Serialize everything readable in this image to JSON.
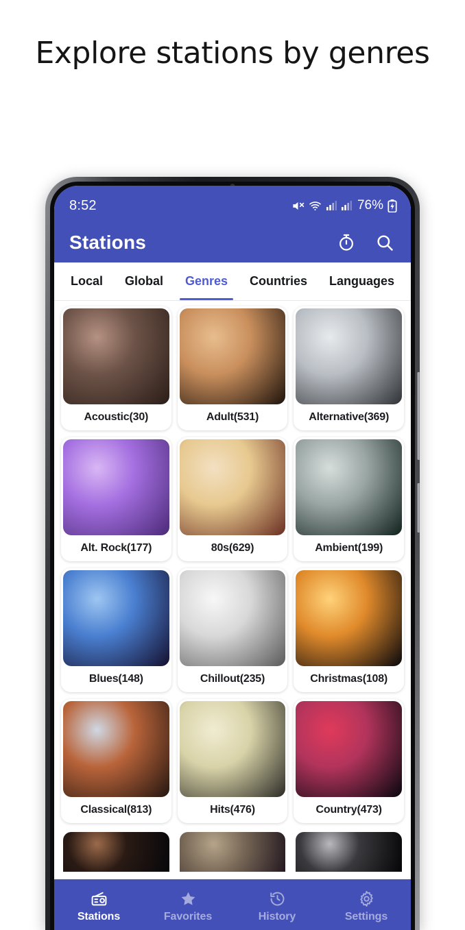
{
  "headline": "Explore stations by genres",
  "statusbar": {
    "time": "8:52",
    "battery_percent": "76%",
    "icons": [
      "mute-icon",
      "wifi-icon",
      "signal-icon",
      "signal-icon",
      "battery-charging-icon"
    ]
  },
  "appbar": {
    "title": "Stations",
    "actions": [
      {
        "name": "sleep-timer-icon",
        "label": "Sleep timer"
      },
      {
        "name": "search-icon",
        "label": "Search"
      }
    ]
  },
  "tabs": [
    {
      "label": "Local",
      "active": false
    },
    {
      "label": "Global",
      "active": false
    },
    {
      "label": "Genres",
      "active": true
    },
    {
      "label": "Countries",
      "active": false
    },
    {
      "label": "Languages",
      "active": false
    }
  ],
  "genres": [
    {
      "label": "Acoustic(30)",
      "name": "Acoustic",
      "count": 30,
      "img": "acoustic-guitar-hand",
      "c1": "#6d5348",
      "c2": "#2a1d17",
      "c3": "#b59182"
    },
    {
      "label": "Adult(531)",
      "name": "Adult",
      "count": 531,
      "img": "couple-embrace",
      "c1": "#c98f5d",
      "c2": "#1d120b",
      "c3": "#e8bd8e"
    },
    {
      "label": "Alternative(369)",
      "name": "Alternative",
      "count": 369,
      "img": "band-white-suits-stage",
      "c1": "#b9bec4",
      "c2": "#2e3135",
      "c3": "#e7eaec"
    },
    {
      "label": "Alt. Rock(177)",
      "name": "Alt. Rock",
      "count": 177,
      "img": "purple-stage-performer",
      "c1": "#a46fe0",
      "c2": "#4b2a78",
      "c3": "#d9b7f5"
    },
    {
      "label": "80s(629)",
      "name": "80s",
      "count": 629,
      "img": "eighties-big-hair-crowd",
      "c1": "#e7c98f",
      "c2": "#6a2e22",
      "c3": "#f3e0c2"
    },
    {
      "label": "Ambient(199)",
      "name": "Ambient",
      "count": 199,
      "img": "waterfall-forest-dark",
      "c1": "#9aa6a4",
      "c2": "#10211c",
      "c3": "#d6dedb"
    },
    {
      "label": "Blues(148)",
      "name": "Blues",
      "count": 148,
      "img": "blues-guitarist-tuxedo",
      "c1": "#4a7fd0",
      "c2": "#140f2e",
      "c3": "#9ec6f2"
    },
    {
      "label": "Chillout(235)",
      "name": "Chillout",
      "count": 235,
      "img": "cat-on-sleeping-person-bw",
      "c1": "#d8d8d8",
      "c2": "#5a5a5a",
      "c3": "#f7f7f7"
    },
    {
      "label": "Christmas(108)",
      "name": "Christmas",
      "count": 108,
      "img": "christmas-tree-lights",
      "c1": "#e08a2b",
      "c2": "#07070c",
      "c3": "#ffd27a"
    },
    {
      "label": "Classical(813)",
      "name": "Classical",
      "count": 813,
      "img": "cellist-playing",
      "c1": "#b9643a",
      "c2": "#241610",
      "c3": "#cfd8e4"
    },
    {
      "label": "Hits(476)",
      "name": "Hits",
      "count": 476,
      "img": "school-hallway-dancers",
      "c1": "#d8d3a8",
      "c2": "#2c2b26",
      "c3": "#f0ecd2"
    },
    {
      "label": "Country(473)",
      "name": "Country",
      "count": 473,
      "img": "dancer-red-neon-stage",
      "c1": "#b2345c",
      "c2": "#07070e",
      "c3": "#e03a5a"
    },
    {
      "label": "",
      "name": "row5-a",
      "count": 0,
      "img": "dark-stage-partial",
      "c1": "#2a1a14",
      "c2": "#07070a",
      "c3": "#9c6a4a"
    },
    {
      "label": "",
      "name": "row5-b",
      "count": 0,
      "img": "couch-interior-partial",
      "c1": "#7a6a58",
      "c2": "#231820",
      "c3": "#b6a48a"
    },
    {
      "label": "",
      "name": "row5-c",
      "count": 0,
      "img": "dark-equipment-partial",
      "c1": "#3a3a3e",
      "c2": "#050507",
      "c3": "#b9b9bd"
    }
  ],
  "bottomnav": [
    {
      "label": "Stations",
      "icon": "radio-icon",
      "active": true
    },
    {
      "label": "Favorites",
      "icon": "star-icon",
      "active": false
    },
    {
      "label": "History",
      "icon": "history-icon",
      "active": false
    },
    {
      "label": "Settings",
      "icon": "gear-icon",
      "active": false
    }
  ],
  "colors": {
    "brand_blue": "#4350b8",
    "accent_indigo": "#4f5bd5",
    "card_white": "#ffffff",
    "text_dark": "#1b1c20"
  }
}
